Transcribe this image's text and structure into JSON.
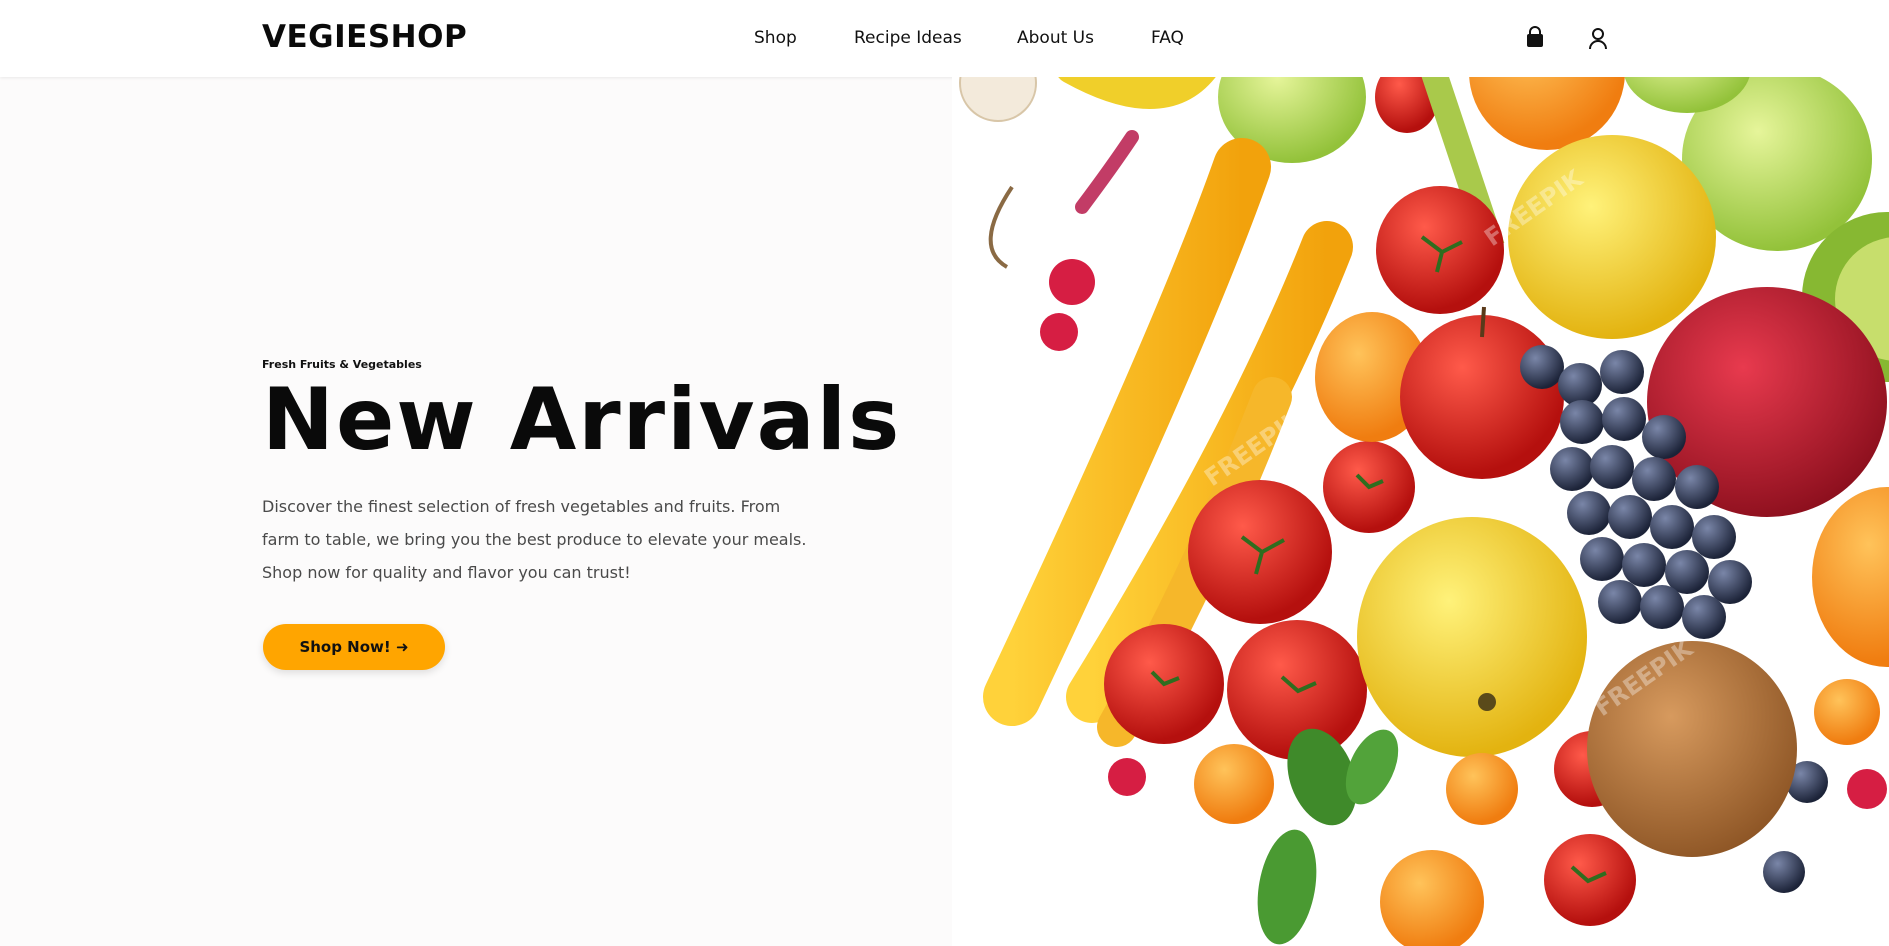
{
  "header": {
    "logo": "VEGIESHOP",
    "nav": [
      {
        "label": "Shop"
      },
      {
        "label": "Recipe Ideas"
      },
      {
        "label": "About Us"
      },
      {
        "label": "FAQ"
      }
    ],
    "icons": [
      "shopping-bag-icon",
      "user-icon"
    ]
  },
  "hero": {
    "eyebrow": "Fresh Fruits & Vegetables",
    "title": "New Arrivals",
    "description": "Discover the finest selection of fresh vegetables and fruits. From farm to table, we bring you the best produce to elevate your meals. Shop now for quality and flavor you can trust!",
    "cta_label": "Shop Now! ➜",
    "watermark": "FREEPIK"
  },
  "colors": {
    "accent": "#ffa500",
    "background": "#fcfbfb",
    "text": "#0a0a0a"
  }
}
